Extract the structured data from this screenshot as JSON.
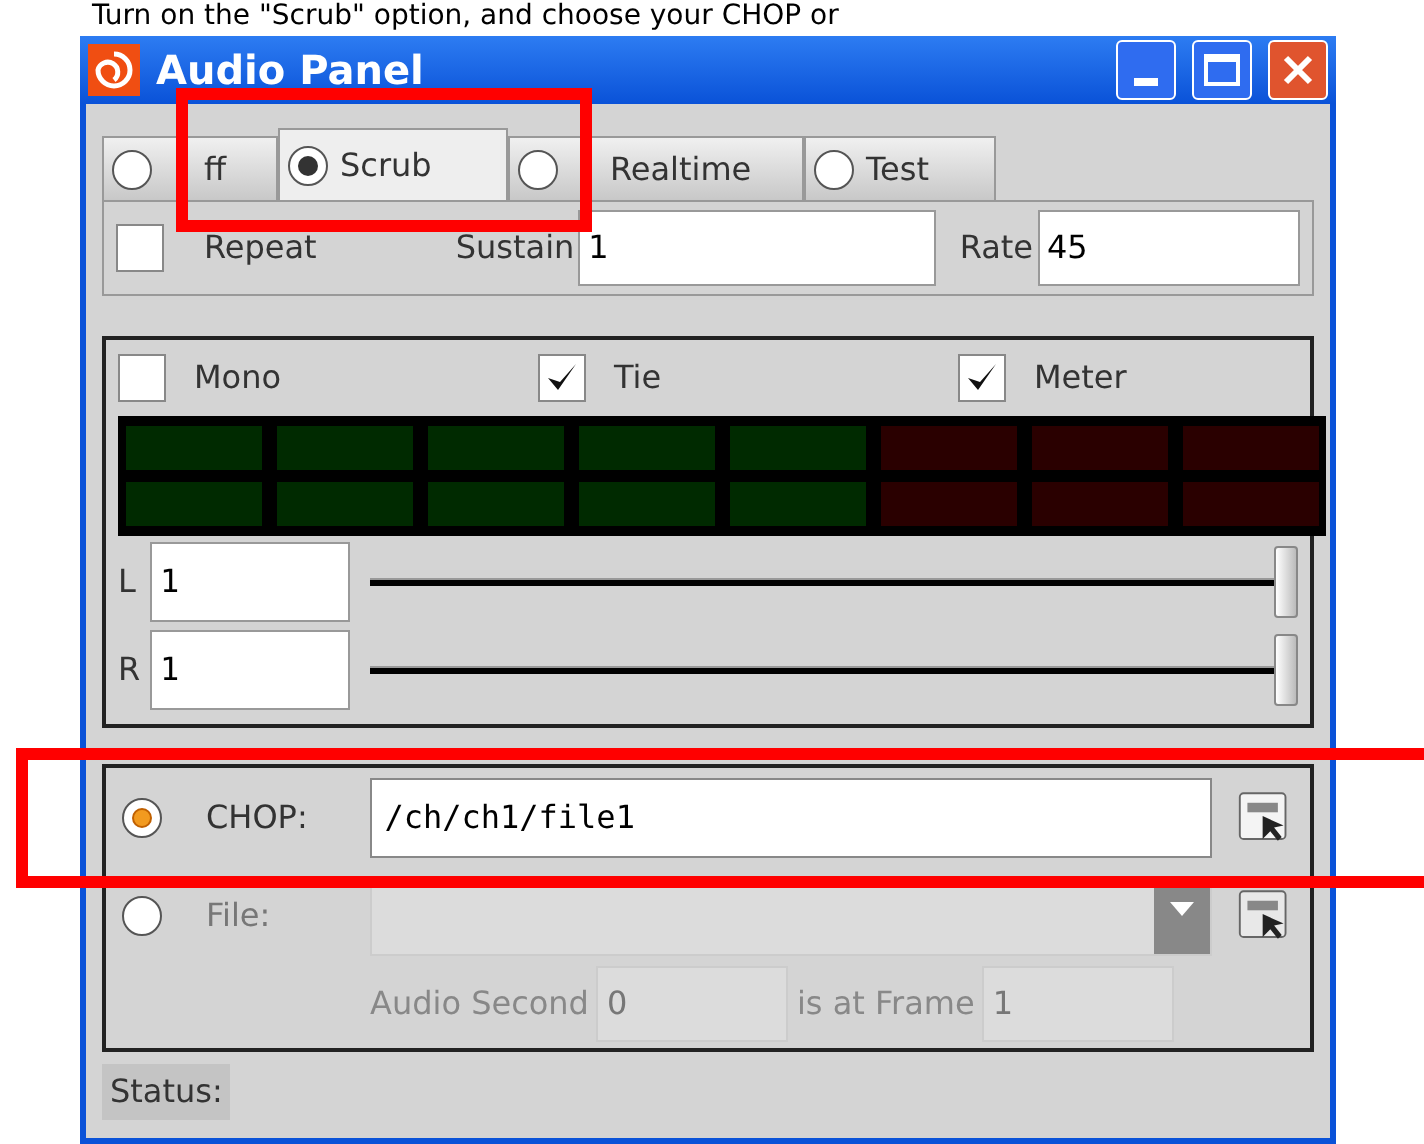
{
  "caption": "Turn on the \"Scrub\" option, and choose your CHOP or",
  "window": {
    "title": "Audio Panel"
  },
  "tabs": [
    {
      "label": "ff",
      "selected": false
    },
    {
      "label": "Scrub",
      "selected": true
    },
    {
      "label": "Realtime",
      "selected": false
    },
    {
      "label": "Test",
      "selected": false
    }
  ],
  "repeat": {
    "label": "Repeat",
    "checked": false
  },
  "sustain": {
    "label": "Sustain",
    "value": "1"
  },
  "rate": {
    "label": "Rate",
    "value": "45"
  },
  "options": [
    {
      "label": "Mono",
      "checked": false
    },
    {
      "label": "Tie",
      "checked": true
    },
    {
      "label": "Meter",
      "checked": true
    }
  ],
  "channels": [
    {
      "label": "L",
      "value": "1",
      "level": 1
    },
    {
      "label": "R",
      "value": "1",
      "level": 1
    }
  ],
  "sources": [
    {
      "label": "CHOP:",
      "selected": true,
      "value": "/ch/ch1/file1",
      "disabled": false
    },
    {
      "label": "File:",
      "selected": false,
      "disabled": true
    }
  ],
  "sync": {
    "label_1": "Audio Second",
    "value_1": "0",
    "label_2": "is at Frame",
    "value_2": "1",
    "disabled": true
  },
  "status_bar": {
    "label": "Status:"
  }
}
